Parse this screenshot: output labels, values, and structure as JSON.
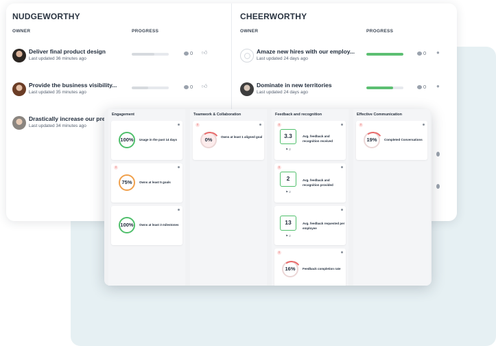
{
  "nudgeworthy": {
    "title": "NUDGEWORTHY",
    "owner_header": "OWNER",
    "progress_header": "PROGRESS",
    "goals": [
      {
        "title": "Deliver final product design",
        "updated": "Last updated 36 minutes ago",
        "comments": "0",
        "progress": 0.62
      },
      {
        "title": "Provide the business visibility...",
        "updated": "Last updated 35 minutes ago",
        "comments": "0",
        "progress": 0.45
      },
      {
        "title": "Drastically increase our pres",
        "updated": "Last updated 34 minutes ago"
      }
    ]
  },
  "cheerworthy": {
    "title": "CHEERWORTHY",
    "owner_header": "OWNER",
    "progress_header": "PROGRESS",
    "goals": [
      {
        "title": "Amaze new hires with our employ...",
        "updated": "Last updated 24 days ago",
        "comments": "0",
        "progress": 1.0
      },
      {
        "title": "Dominate in new territories",
        "updated": "Last updated 24 days ago",
        "comments": "0",
        "progress": 0.72
      }
    ]
  },
  "board": {
    "lanes": [
      {
        "title": "Engagement",
        "cards": [
          {
            "value": "100%",
            "label": "Usage in the past 14 days"
          },
          {
            "value": "75%",
            "label": "Owns at least 5 goals"
          },
          {
            "value": "100%",
            "label": "Owns at least 3 milestones"
          }
        ]
      },
      {
        "title": "Teamwork & Collaboration",
        "cards": [
          {
            "value": "0%",
            "label": "Owns at least 1 aligned goal"
          }
        ]
      },
      {
        "title": "Feedback and recognition",
        "cards": [
          {
            "value": "3.3",
            "label": "Avg. feedback and recognition received",
            "flag": "2"
          },
          {
            "value": "2",
            "label": "Avg. feedback and recognition provided",
            "flag": "2"
          },
          {
            "value": "13",
            "label": "Avg. feedback requested per employee",
            "flag": "2"
          },
          {
            "value": "16%",
            "label": "Feedback completion rate"
          }
        ]
      },
      {
        "title": "Effective Communication",
        "cards": [
          {
            "value": "19%",
            "label": "Completed Conversations"
          }
        ]
      }
    ]
  },
  "colors": {
    "green": "#4fbf6b",
    "orange": "#f0a04b",
    "red": "#e96a6a",
    "backdrop": "#e6f0f3"
  },
  "icons": {
    "comment": "speech-bubble-icon",
    "like": "thumbs-up-icon",
    "warning": "alert-icon",
    "menu": "more-dot-icon",
    "flag": "flag-icon"
  }
}
